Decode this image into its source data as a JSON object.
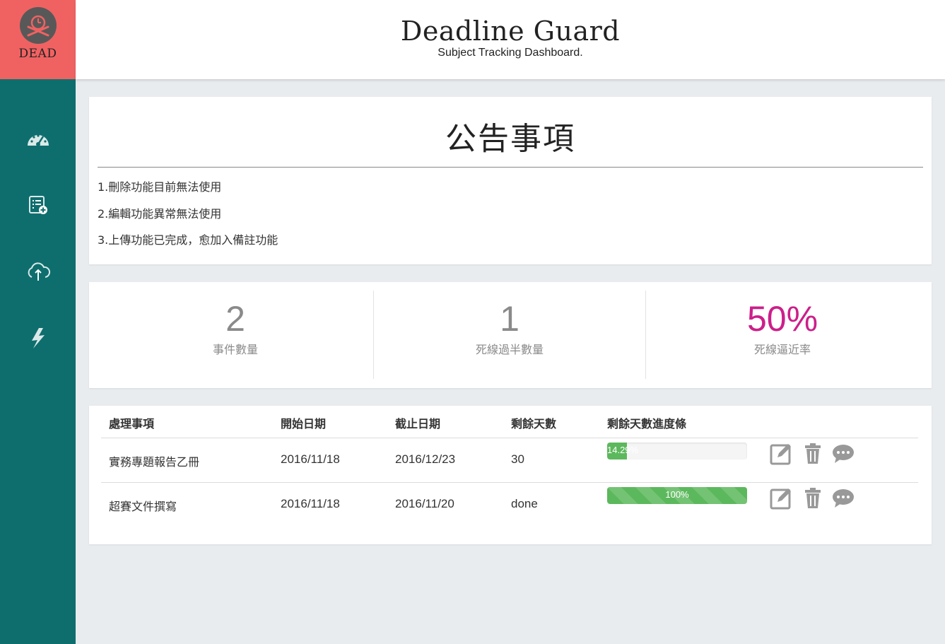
{
  "brand": {
    "logo_text": "DEAD",
    "colors": {
      "logo_bg": "#f06262",
      "sidebar_bg": "#0e6e6e",
      "accent_pink": "#cc1f8a",
      "progress_green": "#5cb85c"
    }
  },
  "header": {
    "title": "Deadline Guard",
    "subtitle": "Subject Tracking Dashboard."
  },
  "sidebar": {
    "items": [
      {
        "icon": "dashboard-gauge-icon"
      },
      {
        "icon": "add-list-icon"
      },
      {
        "icon": "cloud-upload-icon"
      },
      {
        "icon": "lightning-icon"
      }
    ]
  },
  "notice": {
    "title": "公告事項",
    "items": [
      "1.刪除功能目前無法使用",
      "2.編輯功能異常無法使用",
      "3.上傳功能已完成，愈加入備註功能"
    ]
  },
  "stats": [
    {
      "value": "2",
      "label": "事件數量"
    },
    {
      "value": "1",
      "label": "死線過半數量"
    },
    {
      "value": "50%",
      "label": "死線逼近率"
    }
  ],
  "table": {
    "headers": [
      "處理事項",
      "開始日期",
      "截止日期",
      "剩餘天數",
      "剩餘天數進度條"
    ],
    "rows": [
      {
        "task": "實務專題報告乙冊",
        "start": "2016/11/18",
        "end": "2016/12/23",
        "remaining": "30",
        "progress": 14.29,
        "progress_label": "14.29%"
      },
      {
        "task": "超賽文件撰寫",
        "start": "2016/11/18",
        "end": "2016/11/20",
        "remaining": "done",
        "progress": 100,
        "progress_label": "100%"
      }
    ],
    "actions": [
      "edit-icon",
      "trash-icon",
      "comment-icon"
    ]
  }
}
